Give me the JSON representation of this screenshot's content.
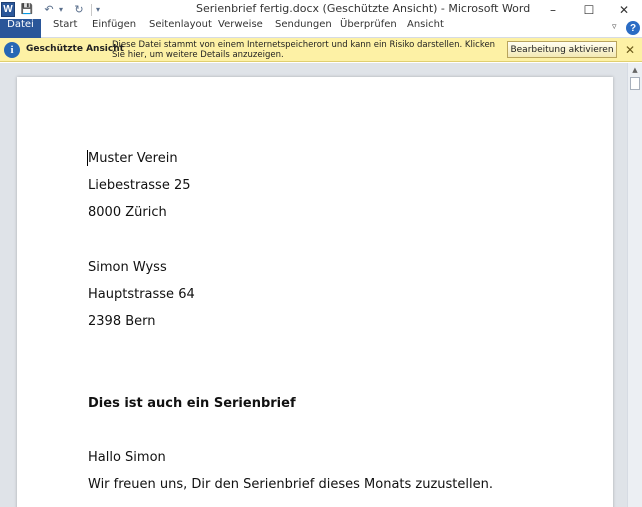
{
  "window": {
    "title": "Serienbrief fertig.docx (Geschützte Ansicht)  -  Microsoft Word",
    "app_logo": "W",
    "controls": {
      "minimize": "–",
      "maximize": "☐",
      "close": "✕"
    }
  },
  "quick_access": {
    "save_icon": "💾",
    "undo_icon": "↶",
    "undo_dropdown": "▾",
    "redo_icon": "↻",
    "customize_icon": "▾"
  },
  "ribbon": {
    "file_tab": "Datei",
    "tabs": [
      "Start",
      "Einfügen",
      "Seitenlayout",
      "Verweise",
      "Sendungen",
      "Überprüfen",
      "Ansicht"
    ],
    "minimize_ribbon_icon": "▿",
    "help_icon": "?"
  },
  "protected_view": {
    "title": "Geschützte Ansicht",
    "message": "Diese Datei stammt von einem Internetspeicherort und kann ein Risiko darstellen. Klicken Sie hier, um weitere Details anzuzeigen.",
    "enable_button": "Bearbeitung aktivieren",
    "close_icon": "✕",
    "colors": {
      "background": "#fdf1a5",
      "icon": "#2667b4"
    }
  },
  "document": {
    "paragraphs": [
      {
        "text": "Muster Verein",
        "bold": false
      },
      {
        "text": "Liebestrasse 25",
        "bold": false
      },
      {
        "text": "8000 Zürich",
        "bold": false
      },
      {
        "text": "Simon Wyss",
        "bold": false
      },
      {
        "text": "Hauptstrasse 64",
        "bold": false
      },
      {
        "text": "2398 Bern",
        "bold": false
      },
      {
        "text": "Dies ist auch ein Serienbrief",
        "bold": true
      },
      {
        "text": "Hallo Simon",
        "bold": false
      },
      {
        "text": "Wir freuen uns, Dir den Serienbrief dieses Monats zuzustellen.",
        "bold": false
      }
    ]
  },
  "scrollbar": {
    "up_icon": "▲"
  }
}
